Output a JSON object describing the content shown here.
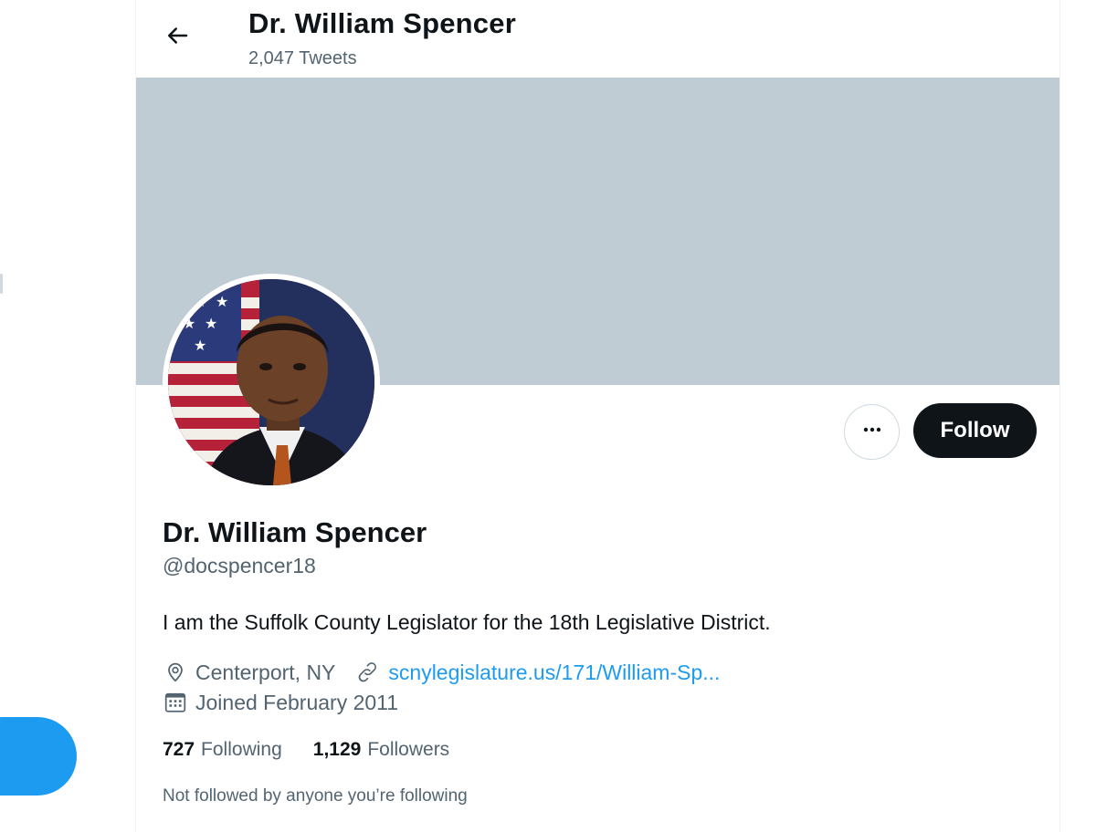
{
  "header": {
    "title": "Dr. William Spencer",
    "tweet_count": "2,047 Tweets"
  },
  "profile": {
    "name": "Dr. William Spencer",
    "handle": "@docspencer18",
    "bio": "I am the Suffolk County Legislator for the 18th Legislative District.",
    "location": "Centerport, NY",
    "website": "scnylegislature.us/171/William-Sp...",
    "joined": "Joined February 2011"
  },
  "actions": {
    "follow_label": "Follow",
    "more_label": "···"
  },
  "stats": {
    "following_count": "727",
    "following_label": "Following",
    "followers_count": "1,129",
    "followers_label": "Followers"
  },
  "followed_by_note": "Not followed by anyone you’re following",
  "icons": {
    "back": "arrow-left-icon",
    "more": "more-horizontal-icon",
    "location": "location-pin-icon",
    "link": "link-icon",
    "calendar": "calendar-icon"
  },
  "colors": {
    "accent": "#1d9bf0",
    "banner": "#c0ccd3",
    "text_primary": "#0f1419",
    "text_secondary": "#536471",
    "follow_button": "#0f1419"
  }
}
